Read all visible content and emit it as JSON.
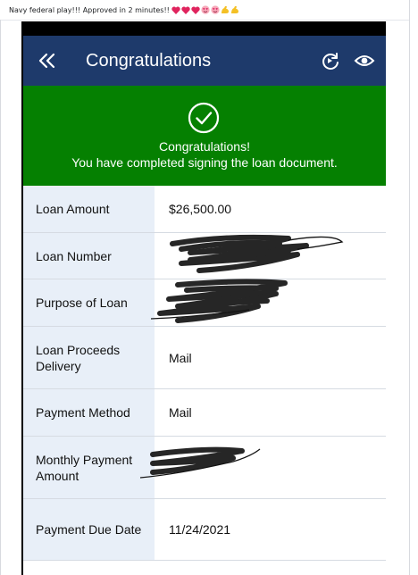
{
  "post": {
    "caption": "Navy federal play!!! Approved in 2 minutes!!",
    "emojis": [
      "red-heart",
      "red-heart",
      "red-heart",
      "smiling-face-with-heart-eyes",
      "smiling-face-with-heart-eyes",
      "flexed-biceps",
      "flexed-biceps"
    ]
  },
  "header": {
    "title": "Congratulations",
    "icons": [
      "double-chevron-left-icon",
      "refresh-camera-icon",
      "eye-icon"
    ]
  },
  "banner": {
    "icon": "check-circle-icon",
    "line1": "Congratulations!",
    "line2": "You have completed signing the loan document."
  },
  "details": [
    {
      "label": "Loan Amount",
      "value": "$26,500.00"
    },
    {
      "label": "Loan Number",
      "value": ""
    },
    {
      "label": "Purpose of Loan",
      "value": ""
    },
    {
      "label": "Loan Proceeds Delivery",
      "value": "Mail"
    },
    {
      "label": "Payment Method",
      "value": "Mail"
    },
    {
      "label": "Monthly Payment Amount",
      "value": ""
    },
    {
      "label": "Payment Due Date",
      "value": "11/24/2021"
    }
  ],
  "colors": {
    "header_bg": "#1e3a6b",
    "banner_bg": "#058001",
    "label_bg": "#e8eff8",
    "redaction": "#141414"
  }
}
